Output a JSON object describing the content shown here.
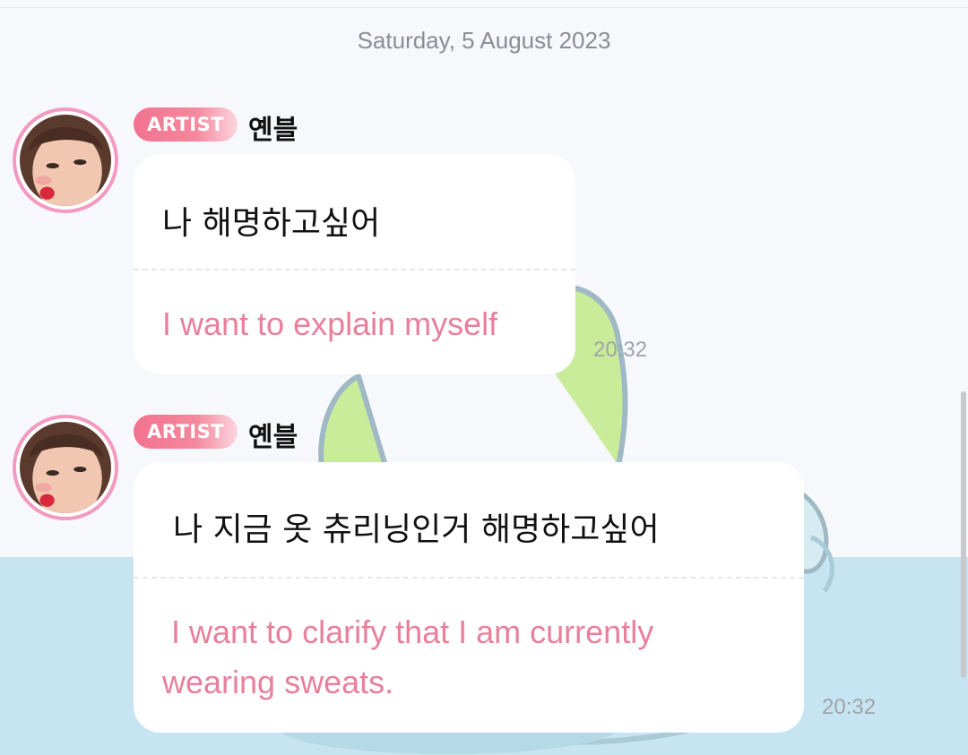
{
  "chat": {
    "date_separator": "Saturday, 5 August 2023",
    "messages": [
      {
        "badge": "ARTIST",
        "sender": "옌블",
        "text_korean": "나 해명하고싶어",
        "text_english": "I want to explain myself",
        "time": "20:32",
        "avatar_icon": "avatar-photo-icon"
      },
      {
        "badge": "ARTIST",
        "sender": "옌블",
        "text_korean": "나 지금 옷 츄리닝인거 해명하고싶어",
        "text_english": "I want to clarify that I am currently wearing sweats.",
        "time": "20:32",
        "avatar_icon": "avatar-photo-icon"
      }
    ]
  },
  "colors": {
    "badge": "#f2728f",
    "translation_text": "#e8809c",
    "avatar_ring": "#f39ac0",
    "background": "#f7f8fb",
    "water": "#c6e4f1"
  }
}
